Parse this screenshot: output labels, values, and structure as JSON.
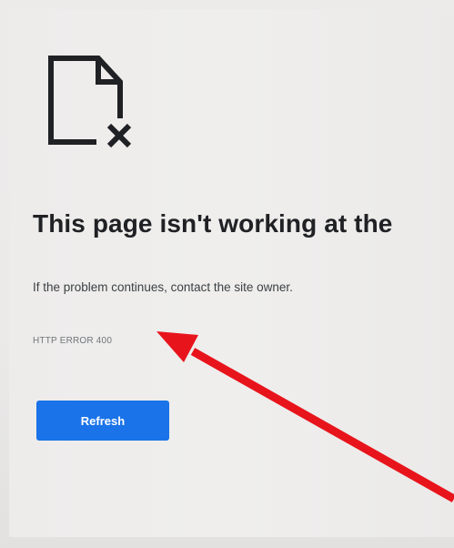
{
  "error_page": {
    "icon": "broken-page-icon",
    "title": "This page isn't working at the",
    "message": "If the problem continues, contact the site owner.",
    "error_code": "HTTP ERROR 400",
    "refresh_label": "Refresh"
  },
  "colors": {
    "button": "#1a73e8",
    "button_text": "#ffffff",
    "title_text": "#202124",
    "annotation_arrow": "#e8141c"
  },
  "annotation": {
    "icon": "red-arrow-icon"
  }
}
